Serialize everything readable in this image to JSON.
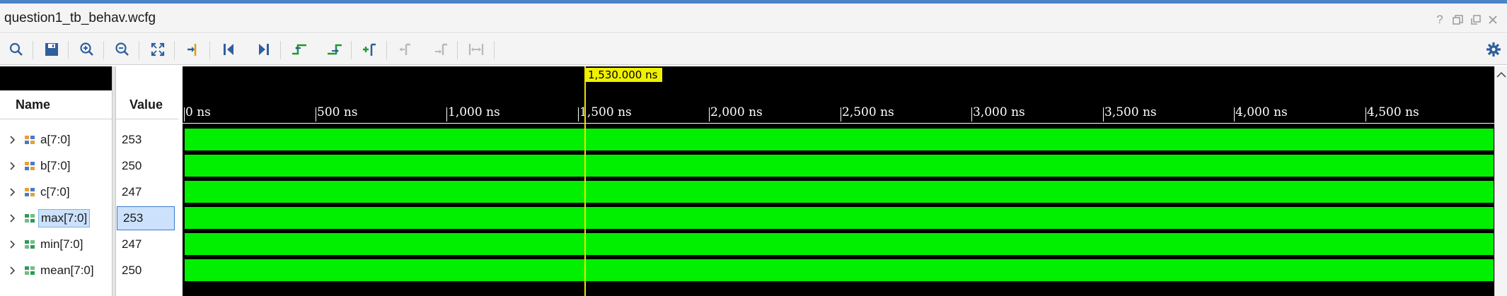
{
  "window": {
    "title": "question1_tb_behav.wcfg",
    "controls": [
      {
        "name": "help-icon",
        "glyph": "?"
      },
      {
        "name": "restore-icon",
        "glyph": "⧉"
      },
      {
        "name": "maximize-icon",
        "glyph": "⬜"
      },
      {
        "name": "close-icon",
        "glyph": "✕"
      }
    ]
  },
  "toolbar": {
    "buttons": [
      {
        "name": "search-icon"
      },
      {
        "name": "save-icon"
      },
      {
        "name": "zoom-in-icon"
      },
      {
        "name": "zoom-out-icon"
      },
      {
        "name": "zoom-fit-icon"
      },
      {
        "name": "go-to-cursor-icon"
      },
      {
        "name": "go-to-time-zero-icon"
      },
      {
        "name": "go-to-last-time-icon"
      },
      {
        "name": "previous-transition-icon"
      },
      {
        "name": "next-transition-icon"
      },
      {
        "name": "add-marker-icon"
      },
      {
        "name": "previous-marker-icon"
      },
      {
        "name": "next-marker-icon"
      },
      {
        "name": "swap-cursors-icon"
      },
      {
        "name": "settings-gear-icon"
      }
    ]
  },
  "columns": {
    "name_header": "Name",
    "value_header": "Value"
  },
  "signals": [
    {
      "name": "a[7:0]",
      "value": "253",
      "kind": "input"
    },
    {
      "name": "b[7:0]",
      "value": "250",
      "kind": "input"
    },
    {
      "name": "c[7:0]",
      "value": "247",
      "kind": "input"
    },
    {
      "name": "max[7:0]",
      "value": "253",
      "kind": "output",
      "selected": true
    },
    {
      "name": "min[7:0]",
      "value": "247",
      "kind": "output"
    },
    {
      "name": "mean[7:0]",
      "value": "250",
      "kind": "output"
    }
  ],
  "timeline": {
    "ticks": [
      "0 ns",
      "500 ns",
      "1,000 ns",
      "1,500 ns",
      "2,000 ns",
      "2,500 ns",
      "3,000 ns",
      "3,500 ns",
      "4,000 ns",
      "4,500 ns"
    ],
    "cursor_label": "1,530.000 ns",
    "wave_color": "#00f000",
    "cursor_color": "#f0e000"
  }
}
